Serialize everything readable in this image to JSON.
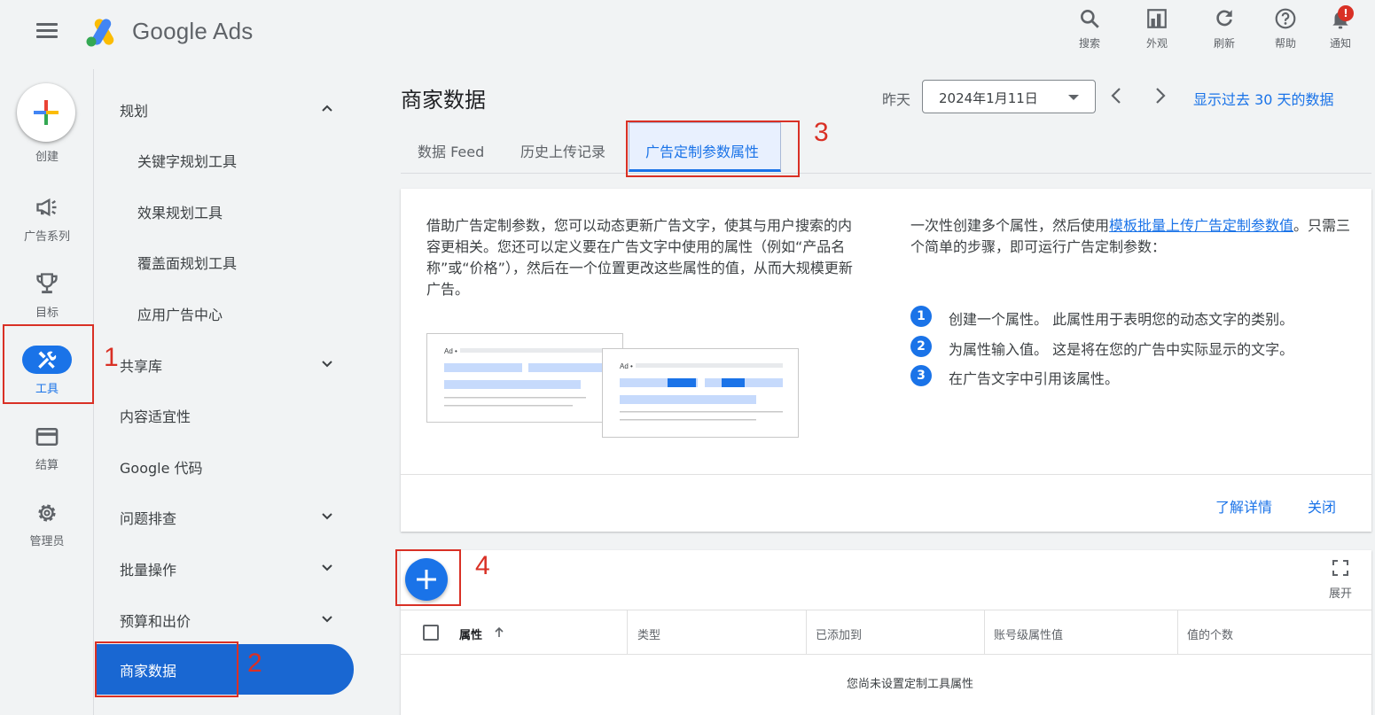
{
  "app": {
    "name": "Google Ads"
  },
  "toolbar": [
    {
      "label": "搜索",
      "icon": "search-icon"
    },
    {
      "label": "外观",
      "icon": "appearance-icon"
    },
    {
      "label": "刷新",
      "icon": "refresh-icon"
    },
    {
      "label": "帮助",
      "icon": "help-icon"
    },
    {
      "label": "通知",
      "icon": "bell-icon",
      "badge": "!"
    }
  ],
  "rail": {
    "create": "创建",
    "campaigns": "广告系列",
    "goals": "目标",
    "tools": "工具",
    "billing": "结算",
    "admin": "管理员"
  },
  "nav": {
    "planning": "规划",
    "keyword_planner": "关键字规划工具",
    "performance_planner": "效果规划工具",
    "reach_planner": "覆盖面规划工具",
    "app_center": "应用广告中心",
    "shared_library": "共享库",
    "content_suitability": "内容适宜性",
    "google_tag": "Google 代码",
    "troubleshooting": "问题排查",
    "bulk_actions": "批量操作",
    "budgets_bids": "预算和出价",
    "business_data": "商家数据"
  },
  "page": {
    "title": "商家数据",
    "date_label": "昨天",
    "date_value": "2024年1月11日",
    "last30": "显示过去 30 天的数据"
  },
  "tabs": {
    "data_feed": "数据 Feed",
    "upload_history": "历史上传记录",
    "ad_customizer": "广告定制参数属性"
  },
  "card": {
    "left_text": "借助广告定制参数，您可以动态更新广告文字，使其与用户搜索的内容更相关。您还可以定义要在广告文字中使用的属性（例如“产品名称”或“价格”），然后在一个位置更改这些属性的值，从而大规模更新广告。",
    "right_pre": "一次性创建多个属性，然后使用",
    "right_link": "模板批量上传广告定制参数值",
    "right_post": "。只需三个简单的步骤，即可运行广告定制参数：",
    "steps": [
      {
        "num": "1",
        "text": "创建一个属性。 此属性用于表明您的动态文字的类别。"
      },
      {
        "num": "2",
        "text": "为属性输入值。 这是将在您的广告中实际显示的文字。"
      },
      {
        "num": "3",
        "text": "在广告文字中引用该属性。"
      }
    ],
    "ad_label": "Ad •",
    "learn_more": "了解详情",
    "close": "关闭"
  },
  "table": {
    "expand_label": "展开",
    "columns": [
      "属性",
      "类型",
      "已添加到",
      "账号级属性值",
      "值的个数"
    ],
    "empty_message": "您尚未设置定制工具属性"
  },
  "annotations": [
    "1",
    "2",
    "3",
    "4"
  ],
  "colors": {
    "accent": "#1a73e8",
    "annotation": "#d93025"
  }
}
